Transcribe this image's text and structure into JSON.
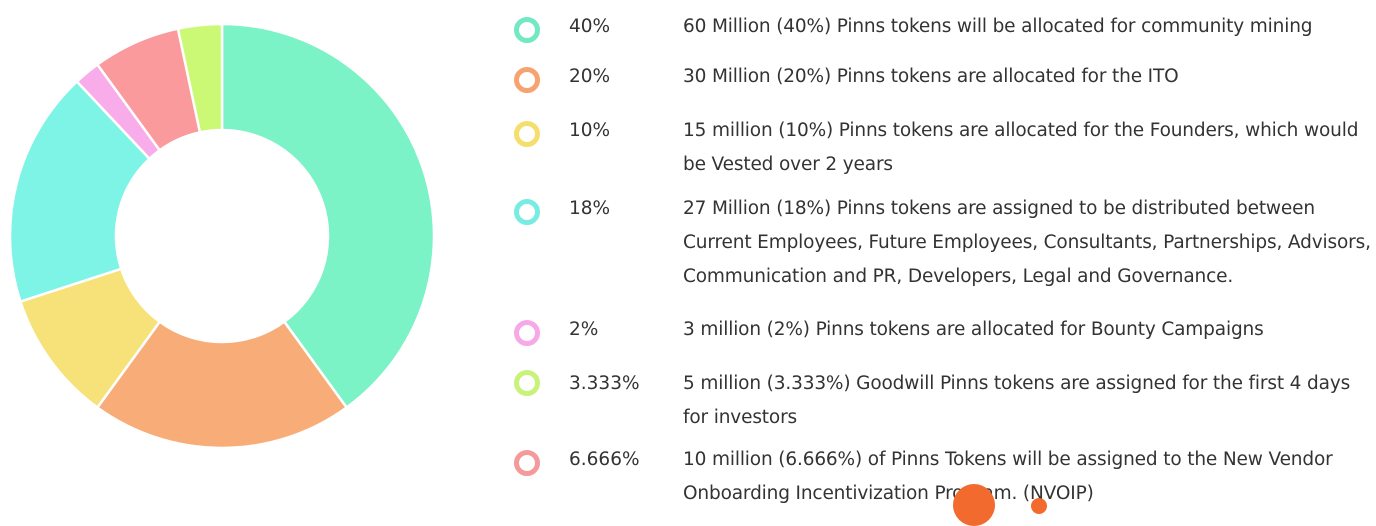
{
  "chart_data": {
    "type": "pie",
    "subtype": "donut",
    "slices": [
      {
        "percent_label": "40%",
        "value": 40,
        "description": "60 Million (40%) Pinns tokens will be allocated for community mining",
        "color": "#7cf2c7",
        "marker_color": "#72e8c3"
      },
      {
        "percent_label": "20%",
        "value": 20,
        "description": "30 Million (20%) Pinns tokens are allocated for the ITO",
        "color": "#f8ad79",
        "marker_color": "#f6a36f"
      },
      {
        "percent_label": "10%",
        "value": 10,
        "description": "15 million (10%) Pinns tokens are allocated for the Founders, which would be Vested over 2 years",
        "color": "#f7e27a",
        "marker_color": "#f6de6d"
      },
      {
        "percent_label": "18%",
        "value": 18,
        "description": "27 Million (18%) Pinns tokens are assigned to be distributed between Current Employees, Future Employees, Consultants, Partnerships, Advisors, Communication and PR, Developers, Legal and Governance.",
        "color": "#7ef4e6",
        "marker_color": "#78ece2"
      },
      {
        "percent_label": "2%",
        "value": 2,
        "description": "3 million (2%) Pinns tokens are allocated for Bounty Campaigns",
        "color": "#f9acea",
        "marker_color": "#f7a8e6"
      },
      {
        "percent_label": "6.666%",
        "value": 6.666,
        "description": "10 million (6.666%) of Pinns Tokens will be assigned to the New Vendor Onboarding Incentivization Program. (NVOIP)",
        "color": "#fb9a9c",
        "marker_color": "#f59a9a"
      },
      {
        "percent_label": "3.333%",
        "value": 3.333,
        "description": "5 million (3.333%) Goodwill Pinns tokens are assigned for the first 4 days for investors",
        "color": "#cbf975",
        "marker_color": "#c8f27a"
      }
    ],
    "legend_order": [
      0,
      1,
      2,
      3,
      4,
      6,
      5
    ],
    "donut_order": [
      0,
      1,
      2,
      3,
      4,
      5,
      6
    ],
    "legend_placement": "right"
  },
  "decor": {
    "blob_color": "#f26a2e"
  }
}
